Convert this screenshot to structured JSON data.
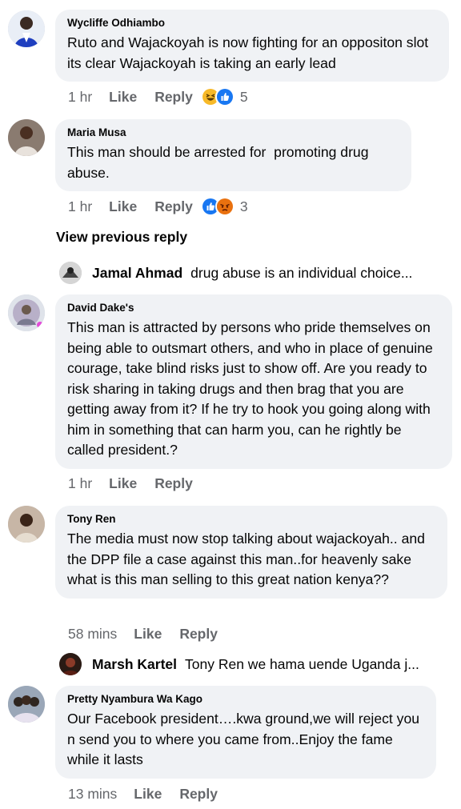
{
  "comments": [
    {
      "author": "Wycliffe Odhiambo",
      "text": "Ruto and Wajackoyah is now fighting for an oppositon slot its clear Wajackoyah is taking an early lead",
      "time": "1 hr",
      "like_label": "Like",
      "reply_label": "Reply",
      "reactions": [
        "haha",
        "like"
      ],
      "reaction_count": "5"
    },
    {
      "author": "Maria Musa",
      "text": "This man should be arrested for  promoting drug abuse.",
      "time": "1 hr",
      "like_label": "Like",
      "reply_label": "Reply",
      "reactions": [
        "like",
        "angry"
      ],
      "reaction_count": "3"
    },
    {
      "author": "David Dake's",
      "text": "This man is attracted by persons who pride themselves on being able to outsmart others, and who in place of genuine courage, take blind risks just to show off. Are you ready to risk sharing in taking drugs and then brag that you are getting away from it? If he try to hook you going along with him in something that can harm you, can he rightly be called president.?",
      "time": "1 hr",
      "like_label": "Like",
      "reply_label": "Reply"
    },
    {
      "author": "Tony Ren",
      "text": "The media must now stop talking about wajackoyah.. and the DPP file a case against this man..for heavenly sake what is this man selling to this great nation kenya??",
      "time": "58 mins",
      "like_label": "Like",
      "reply_label": "Reply"
    },
    {
      "author": "Pretty Nyambura Wa Kago",
      "text": "Our Facebook president….kwa ground,we will reject you n send you to where you came from..Enjoy the fame while it lasts",
      "time": "13 mins",
      "like_label": "Like",
      "reply_label": "Reply"
    }
  ],
  "view_previous_reply": "View previous reply",
  "reply_previews": [
    {
      "author": "Jamal Ahmad",
      "text": "drug abuse is an individual choice..."
    },
    {
      "author": "Marsh Kartel",
      "text": "Tony Ren we hama uende Uganda j..."
    }
  ],
  "colors": {
    "bubble": "#f0f2f5",
    "meta_text": "#65676b",
    "like_blue": "#1877f2",
    "haha_yellow": "#f7b928",
    "angry_orange": "#e9710f"
  },
  "icons": {
    "haha": "haha-reaction-icon",
    "like": "like-reaction-icon",
    "angry": "angry-reaction-icon"
  }
}
